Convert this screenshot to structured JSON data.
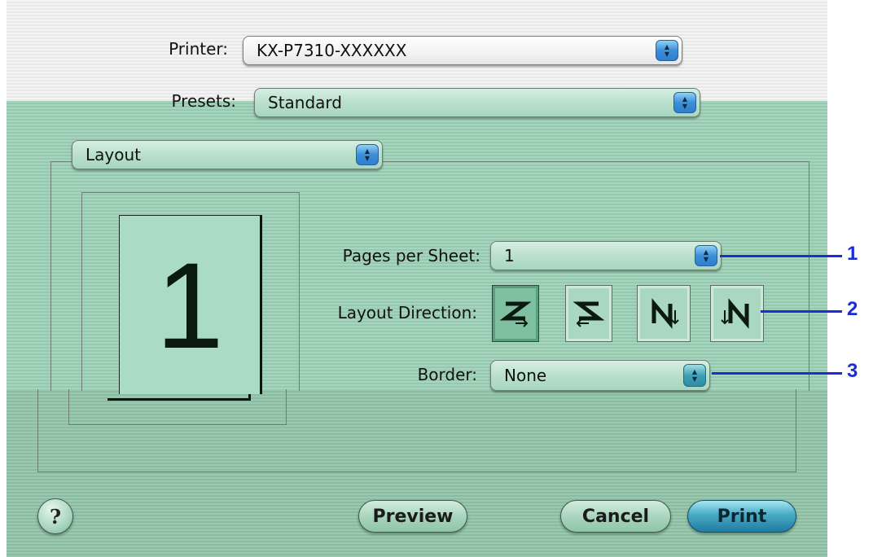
{
  "printer": {
    "label": "Printer:",
    "value": "KX-P7310-XXXXXX"
  },
  "presets": {
    "label": "Presets:",
    "value": "Standard"
  },
  "panel_menu": {
    "value": "Layout"
  },
  "preview": {
    "page_number": "1"
  },
  "pages_per_sheet": {
    "label": "Pages per Sheet:",
    "value": "1"
  },
  "layout_direction": {
    "label": "Layout Direction:",
    "options": [
      {
        "icon": "z-order-icon",
        "selected": true
      },
      {
        "icon": "reverse-z-order-icon",
        "selected": false
      },
      {
        "icon": "n-order-icon",
        "selected": false
      },
      {
        "icon": "reverse-n-order-icon",
        "selected": false
      }
    ]
  },
  "border": {
    "label": "Border:",
    "value": "None"
  },
  "buttons": {
    "help": "?",
    "preview": "Preview",
    "cancel": "Cancel",
    "print": "Print"
  },
  "callouts": [
    "1",
    "2",
    "3"
  ],
  "colors": {
    "panel": "#a6d5bd",
    "accent": "#3b8fd9",
    "callout": "#1a2dd6"
  }
}
